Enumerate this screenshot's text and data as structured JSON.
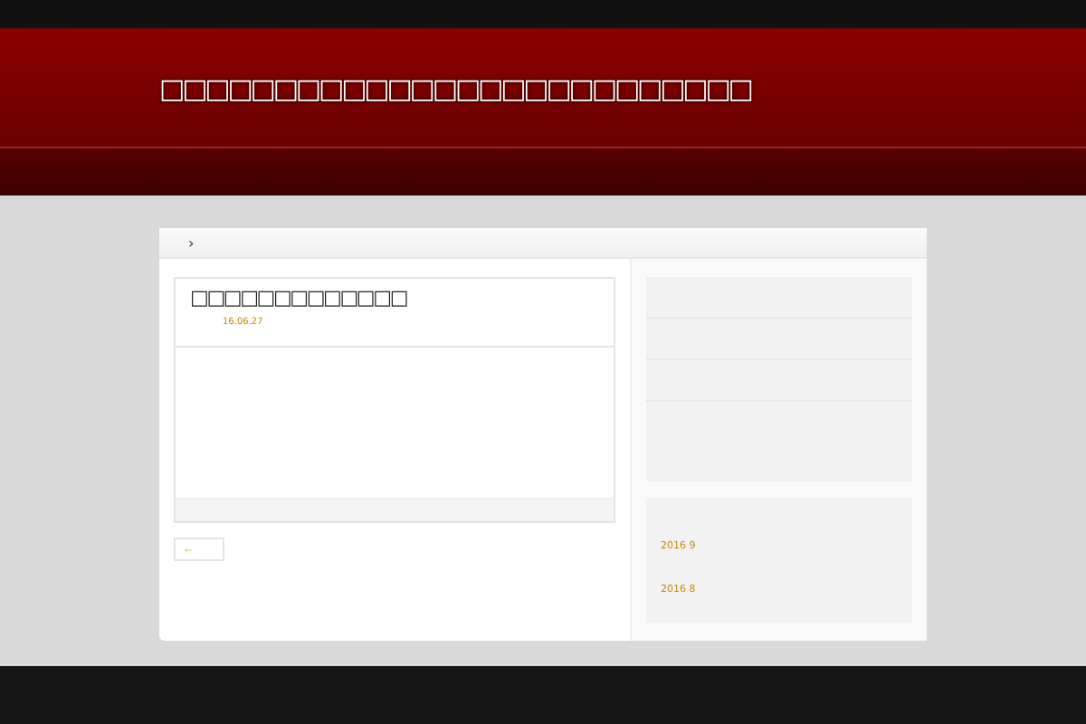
{
  "header": {
    "site_title": "□□□□□□□□□□□□□□□□□□□□□□□□□□"
  },
  "breadcrumb": {
    "separator": "›"
  },
  "post": {
    "title": "□□□□□□□□□□□□□",
    "date": "16.06.27"
  },
  "pager": {
    "back": "←"
  },
  "sidebar": {
    "archives": [
      {
        "label": "2016 9"
      },
      {
        "label": "2016 8"
      }
    ]
  }
}
